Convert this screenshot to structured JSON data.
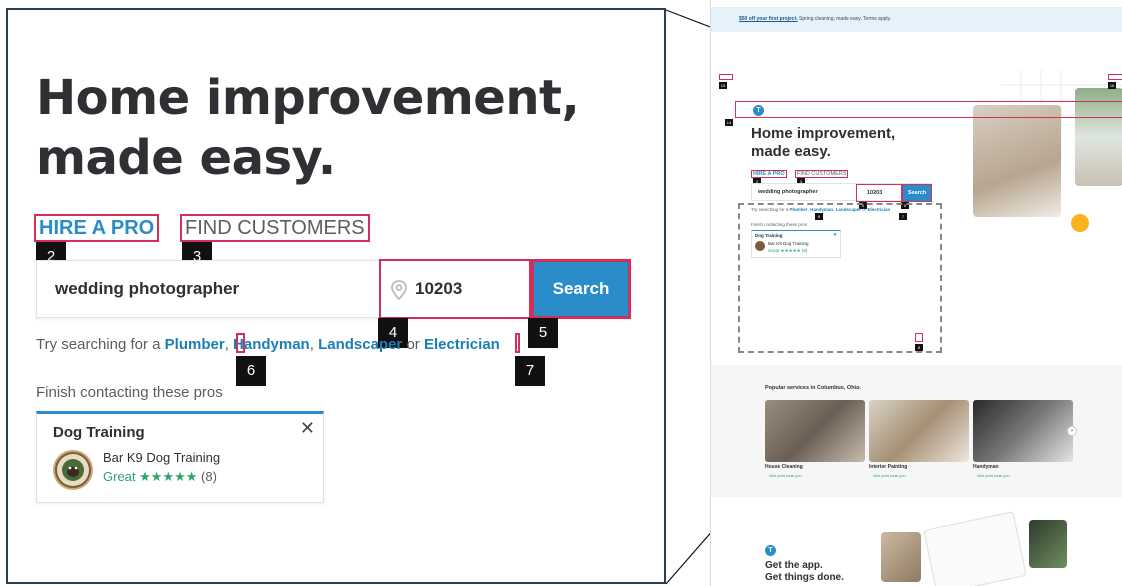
{
  "zoom_panel": {
    "headline_line1": "Home improvement,",
    "headline_line2": "made easy.",
    "tabs": {
      "hire": "HIRE A PRO",
      "find": "FIND CUSTOMERS"
    },
    "search": {
      "keyword_value": "wedding photographer",
      "zip_value": "10203",
      "button_label": "Search"
    },
    "suggestions": {
      "prefix": "Try searching for a",
      "links": [
        "Plumber",
        "Handyman",
        "Landscaper",
        "Electrician"
      ],
      "separator_or": "or"
    },
    "finish_label": "Finish contacting these pros",
    "pro_card": {
      "category": "Dog Training",
      "pro_name": "Bar K9 Dog Training",
      "rating_word": "Great",
      "stars": "★★★★★",
      "review_count": "(8)",
      "close_glyph": "✕"
    },
    "badges": [
      "2",
      "3",
      "4",
      "5",
      "6",
      "7"
    ]
  },
  "mini_page": {
    "promo_link": "$50 off your first project.",
    "promo_rest": "Spring cleaning, made easy. Terms apply.",
    "logo_glyph": "T",
    "headline_line1": "Home improvement,",
    "headline_line2": "made easy.",
    "tab_hire": "HIRE A PRO",
    "tab_find": "FIND CUSTOMERS",
    "keyword": "wedding photographer",
    "zip": "10203",
    "search_label": "Search",
    "try_prefix": "Try searching for a",
    "try_links": [
      "Plumber",
      "Handyman",
      "Landscaper",
      "Electrician"
    ],
    "finish_label": "Finish contacting these pros",
    "card_title": "Dog Training",
    "card_name": "Bar K9 Dog Training",
    "card_rating": "Great ★★★★★ (8)",
    "popular_title": "Popular services in Columbus, Ohio.",
    "services": [
      {
        "label": "House Cleaning",
        "sub": "See pros near you"
      },
      {
        "label": "Interior Painting",
        "sub": "See pros near you"
      },
      {
        "label": "Handyman",
        "sub": "See pros near you"
      }
    ],
    "app_line1": "Get the app.",
    "app_line2": "Get things done.",
    "badges": [
      "1",
      "2",
      "3",
      "4",
      "5",
      "6",
      "7",
      "8",
      "9",
      "10",
      "11",
      "12",
      "13",
      "14",
      "15",
      "16"
    ]
  },
  "colors": {
    "accent_blue": "#2a8cc8",
    "highlight_red": "#d0305a",
    "rating_green": "#2ba36b",
    "badge_black": "#111111"
  },
  "icons": {
    "zip": "map-pin-icon",
    "close": "close-icon",
    "next": "chevron-right-icon"
  }
}
